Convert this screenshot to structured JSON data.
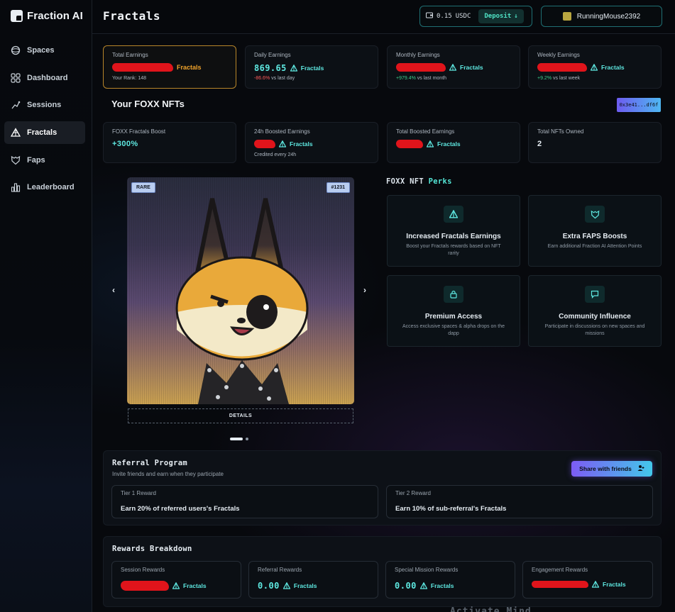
{
  "app": {
    "name": "Fraction AI"
  },
  "sidebar": {
    "items": [
      {
        "label": "Spaces",
        "icon": "spaces-icon"
      },
      {
        "label": "Dashboard",
        "icon": "dashboard-icon"
      },
      {
        "label": "Sessions",
        "icon": "sessions-icon"
      },
      {
        "label": "Fractals",
        "icon": "fractals-icon",
        "active": true
      },
      {
        "label": "Faps",
        "icon": "faps-icon"
      },
      {
        "label": "Leaderboard",
        "icon": "leaderboard-icon"
      }
    ]
  },
  "header": {
    "title": "Fractals",
    "balance": "0.15",
    "currency": "USDC",
    "deposit_label": "Deposit",
    "username": "RunningMouse2392"
  },
  "stats": [
    {
      "label": "Total Earnings",
      "value": "",
      "unit": "Fractals",
      "sub": "Your Rank: 148",
      "redacted": true
    },
    {
      "label": "Daily Earnings",
      "value": "869.65",
      "unit": "Fractals",
      "change": "-86.6%",
      "sub": "vs last day"
    },
    {
      "label": "Monthly Earnings",
      "value": "",
      "unit": "Fractals",
      "change": "+979.4%",
      "sub": "vs last month",
      "redacted": true
    },
    {
      "label": "Weekly Earnings",
      "value": "",
      "unit": "Fractals",
      "change": "+9.2%",
      "sub": "vs last week",
      "redacted": true
    }
  ],
  "nfts": {
    "title": "Your FOXX NFTs",
    "address": "0x3e41...df6f",
    "stats": [
      {
        "label": "FOXX Fractals Boost",
        "value": "+300%"
      },
      {
        "label": "24h Boosted Earnings",
        "value": "",
        "unit": "Fractals",
        "sub": "Credited every 24h",
        "redacted": true
      },
      {
        "label": "Total Boosted Earnings",
        "value": "",
        "unit": "Fractals",
        "redacted": true
      },
      {
        "label": "Total NFTs Owned",
        "value": "2"
      }
    ],
    "card": {
      "rarity": "RARE",
      "id": "#1231",
      "details_label": "DETAILS",
      "prev": "‹",
      "next": "›"
    }
  },
  "perks": {
    "title_prefix": "FOXX NFT",
    "title_accent": "Perks",
    "items": [
      {
        "name": "Increased Fractals Earnings",
        "desc": "Boost your Fractals rewards based on NFT rarity",
        "icon": "fractals-icon"
      },
      {
        "name": "Extra FAPS Boosts",
        "desc": "Earn additional Fraction AI Attention Points",
        "icon": "faps-icon"
      },
      {
        "name": "Premium Access",
        "desc": "Access exclusive spaces & alpha drops on the dapp",
        "icon": "lock-icon"
      },
      {
        "name": "Community Influence",
        "desc": "Participate in discussions on new spaces and missions",
        "icon": "chat-icon"
      }
    ]
  },
  "referral": {
    "title": "Referral Program",
    "subtitle": "Invite friends and earn when they participate",
    "share_label": "Share with friends",
    "tiers": [
      {
        "label": "Tier 1 Reward",
        "value": "Earn 20% of referred users's Fractals"
      },
      {
        "label": "Tier 2 Reward",
        "value": "Earn 10% of sub-referral's Fractals"
      }
    ]
  },
  "rewards": {
    "title": "Rewards Breakdown",
    "items": [
      {
        "label": "Session Rewards",
        "value": "",
        "unit": "Fractals",
        "redacted": true
      },
      {
        "label": "Referral Rewards",
        "value": "0.00",
        "unit": "Fractals"
      },
      {
        "label": "Special Mission Rewards",
        "value": "0.00",
        "unit": "Fractals"
      },
      {
        "label": "Engagement Rewards",
        "value": "",
        "unit": "Fractals",
        "redacted": true
      }
    ]
  },
  "footer_partial": "Activate Mind",
  "colors": {
    "accent": "#5ee8e1",
    "gold": "#f0a32b",
    "negative": "#ff5a5a",
    "positive": "#3ecf8e"
  }
}
